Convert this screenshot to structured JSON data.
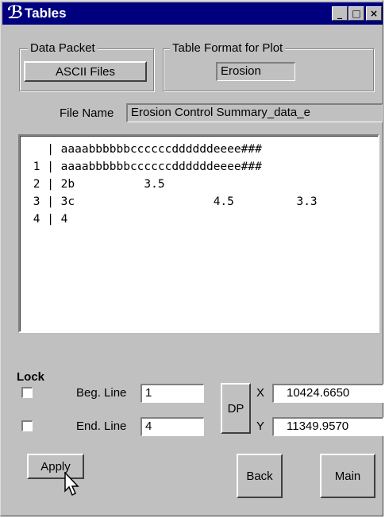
{
  "window": {
    "title": "Tables",
    "icon": "app-logo-icon"
  },
  "data_packet": {
    "label": "Data Packet",
    "button": "ASCII Files"
  },
  "table_format": {
    "label": "Table Format for Plot",
    "value": "Erosion"
  },
  "file_name": {
    "label": "File Name",
    "value": "Erosion Control Summary_data_e"
  },
  "table_text": "   | aaaabbbbbbccccccddddddeeee###\n 1 | aaaabbbbbbccccccddddddeeee###\n 2 | 2b          3.5\n 3 | 3c                    4.5         3.3\n 4 | 4",
  "lock": {
    "label": "Lock"
  },
  "beg_line": {
    "label": "Beg. Line",
    "value": "1"
  },
  "end_line": {
    "label": "End. Line",
    "value": "4"
  },
  "dp_button": "DP",
  "x": {
    "label": "X",
    "value": "10424.6650"
  },
  "y": {
    "label": "Y",
    "value": "11349.9570"
  },
  "buttons": {
    "apply": "Apply",
    "back": "Back",
    "main": "Main"
  }
}
